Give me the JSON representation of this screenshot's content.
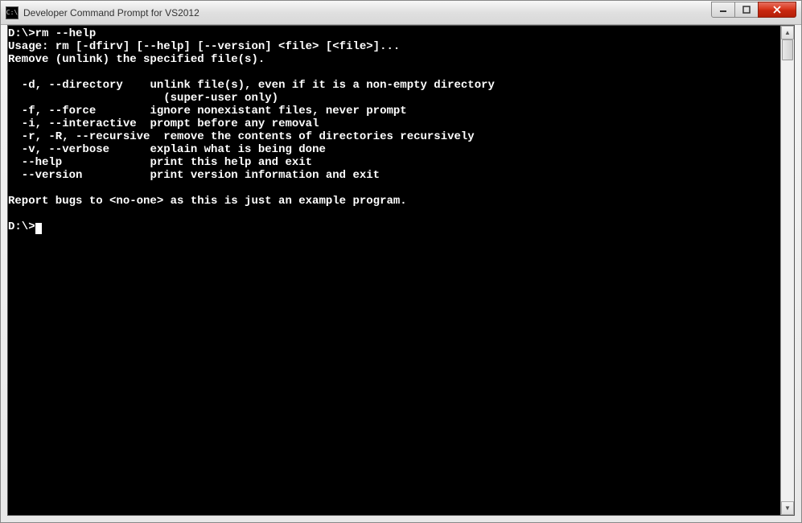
{
  "window": {
    "title": "Developer Command Prompt for VS2012",
    "icon_label": "C:\\"
  },
  "console": {
    "prompt1": "D:\\>",
    "command1": "rm --help",
    "usage": "Usage: rm [-dfirv] [--help] [--version] <file> [<file>]...",
    "description": "Remove (unlink) the specified file(s).",
    "options": [
      {
        "flags": "  -d, --directory    ",
        "desc": "unlink file(s), even if it is a non-empty directory"
      },
      {
        "flags": "                     ",
        "desc": "  (super-user only)"
      },
      {
        "flags": "  -f, --force        ",
        "desc": "ignore nonexistant files, never prompt"
      },
      {
        "flags": "  -i, --interactive  ",
        "desc": "prompt before any removal"
      },
      {
        "flags": "  -r, -R, --recursive",
        "desc": "  remove the contents of directories recursively"
      },
      {
        "flags": "  -v, --verbose      ",
        "desc": "explain what is being done"
      },
      {
        "flags": "  --help             ",
        "desc": "print this help and exit"
      },
      {
        "flags": "  --version          ",
        "desc": "print version information and exit"
      }
    ],
    "footer": "Report bugs to <no-one> as this is just an example program.",
    "prompt2": "D:\\>"
  }
}
